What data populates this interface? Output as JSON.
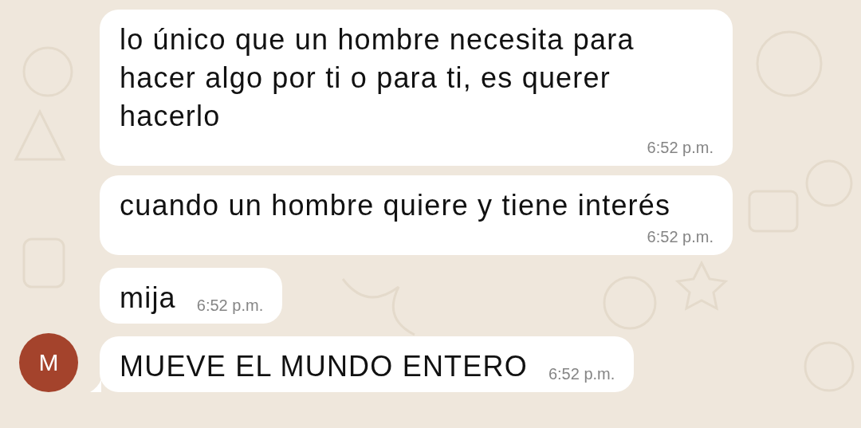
{
  "messages": [
    {
      "text": "lo único que un hombre necesita para hacer algo por ti o para ti, es querer hacerlo",
      "time": "6:52 p.m.",
      "tail": false
    },
    {
      "text": "cuando un hombre quiere y tiene interés",
      "time": "6:52 p.m.",
      "tail": false
    },
    {
      "text": "mija",
      "time": "6:52 p.m.",
      "tail": false
    },
    {
      "text": "MUEVE EL MUNDO ENTERO",
      "time": "6:52 p.m.",
      "tail": true,
      "avatar": {
        "letter": "M",
        "color": "#a4432c"
      }
    }
  ]
}
